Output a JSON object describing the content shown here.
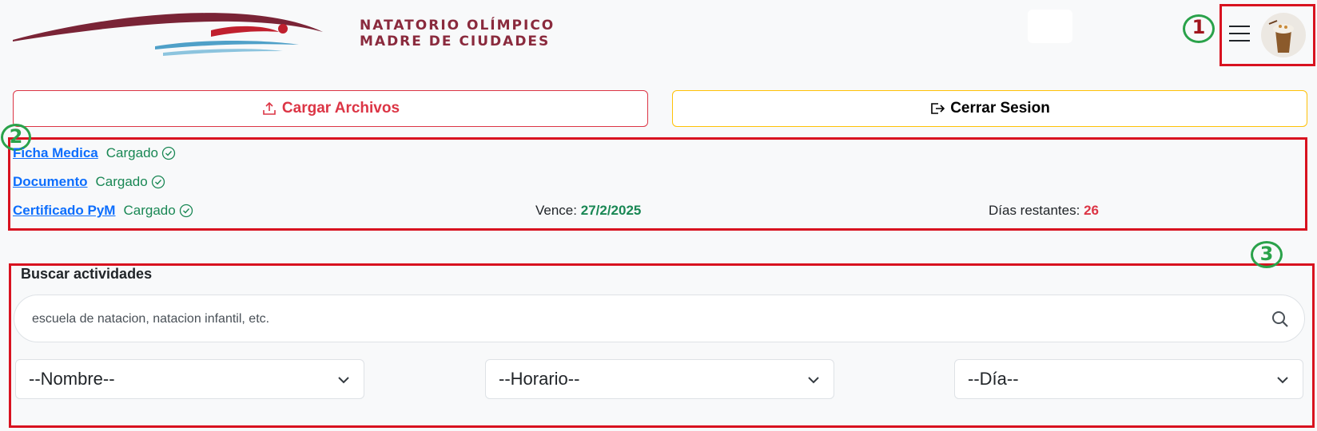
{
  "brand": {
    "line1": "NATATORIO OLÍMPICO",
    "line2": "MADRE DE CIUDADES"
  },
  "markers": [
    "1",
    "2",
    "3"
  ],
  "header": {
    "menu_icon": "hamburger-icon",
    "avatar": "user-avatar"
  },
  "actions": {
    "upload_label": "Cargar Archivos",
    "logout_label": "Cerrar Sesion"
  },
  "documents": [
    {
      "name": "Ficha Medica",
      "status": "Cargado"
    },
    {
      "name": "Documento",
      "status": "Cargado"
    },
    {
      "name": "Certificado PyM",
      "status": "Cargado"
    }
  ],
  "certificate": {
    "expiry_label": "Vence:",
    "expiry_value": "27/2/2025",
    "days_label": "Días restantes:",
    "days_value": "26"
  },
  "search": {
    "title": "Buscar actividades",
    "placeholder": "escuela de natacion, natacion infantil, etc."
  },
  "filters": {
    "nombre": "--Nombre--",
    "horario": "--Horario--",
    "dia": "--Día--"
  },
  "colors": {
    "danger": "#dc3545",
    "success": "#198754",
    "warning": "#ffc107",
    "link": "#0d6efd",
    "annotation_red": "#d8121f",
    "annotation_green": "#2aa24a",
    "brand": "#8a2a3d"
  }
}
